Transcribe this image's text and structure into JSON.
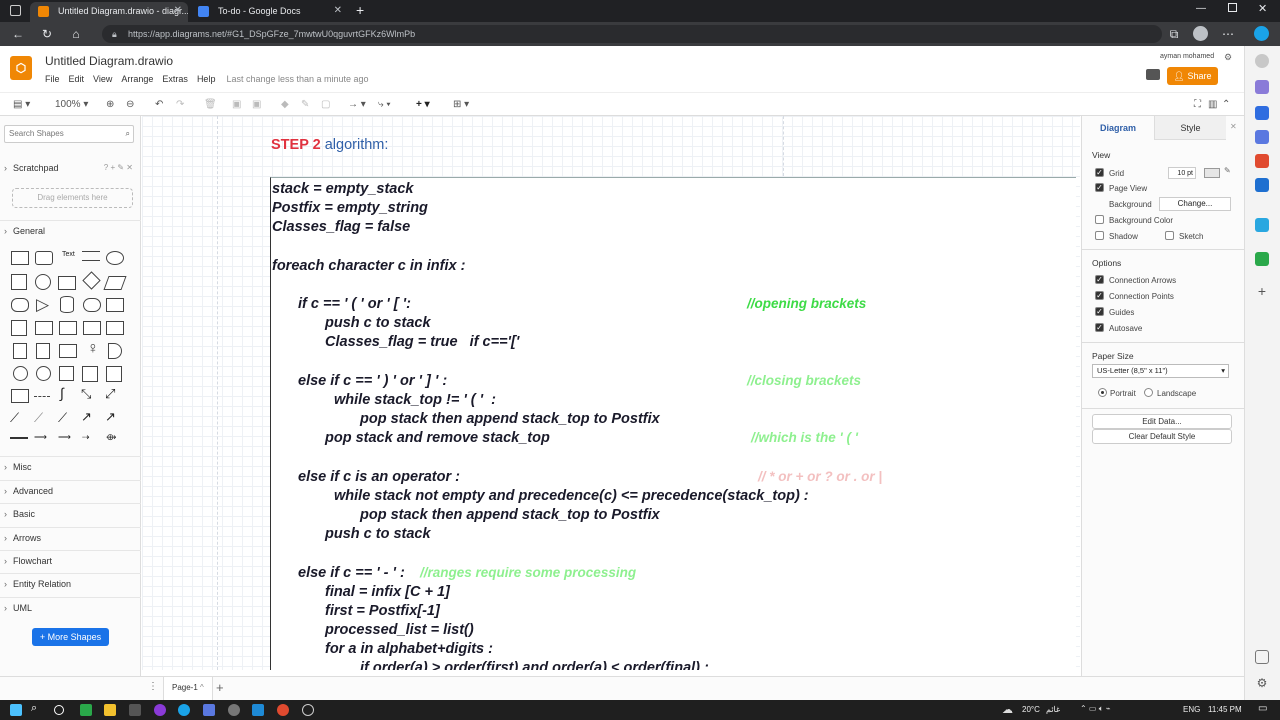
{
  "browser": {
    "tabs": [
      {
        "label": "Untitled Diagram.drawio - diagr...",
        "active": true
      },
      {
        "label": "To-do - Google Docs",
        "active": false
      }
    ],
    "url": "https://app.diagrams.net/#G1_DSpGFze_7mwtwU0qguvrtGFKz6WlmPb"
  },
  "app": {
    "title": "Untitled Diagram.drawio",
    "menu": [
      "File",
      "Edit",
      "View",
      "Arrange",
      "Extras",
      "Help"
    ],
    "last_change": "Last change less than a minute ago",
    "user": "ayman mohamed",
    "share_label": "Share",
    "zoom": "100%"
  },
  "left_panel": {
    "search_placeholder": "Search Shapes",
    "scratchpad": "Scratchpad",
    "drop_hint": "Drag elements here",
    "sections": [
      "General",
      "Misc",
      "Advanced",
      "Basic",
      "Arrows",
      "Flowchart",
      "Entity Relation",
      "UML"
    ],
    "more_shapes": "+ More Shapes"
  },
  "canvas": {
    "heading_step": "STEP 2",
    "heading_rest": "algorithm:",
    "lines": [
      "stack = empty_stack",
      "Postfix = empty_string",
      "Classes_flag = false",
      "foreach character c in infix :",
      "if c == ' ( ' or ' [ ':",
      "push c to stack",
      "Classes_flag = true   if c=='['",
      "else if c == ' ) ' or ' ] ' :",
      "while stack_top != ' ( '  :",
      "pop stack then append stack_top to Postfix",
      "pop stack and remove stack_top",
      "else if c is an operator :",
      "while stack not empty and precedence(c) <= precedence(stack_top) :",
      "pop stack then append stack_top to Postfix",
      "push c to stack",
      "else if c == ' - ' :",
      "final = infix [C + 1]",
      "first = Postfix[-1]",
      "processed_list = list()",
      "for a in alphabet+digits :",
      "if order(a) > order(first) and order(a) < order(final) :"
    ],
    "comments": {
      "opening": "//opening brackets",
      "closing": "//closing brackets",
      "which": "//which is the ' ( '",
      "ops": "// * or + or ? or . or |",
      "ranges": "//ranges require some processing"
    }
  },
  "right_panel": {
    "tabs": [
      "Diagram",
      "Style"
    ],
    "view_head": "View",
    "grid_label": "Grid",
    "grid_value": "10 pt",
    "page_view": "Page View",
    "background": "Background",
    "change_btn": "Change...",
    "bg_color": "Background Color",
    "shadow": "Shadow",
    "sketch": "Sketch",
    "options_head": "Options",
    "options": [
      "Connection Arrows",
      "Connection Points",
      "Guides",
      "Autosave"
    ],
    "paper_head": "Paper Size",
    "paper_value": "US-Letter (8,5\" x 11\")",
    "portrait": "Portrait",
    "landscape": "Landscape",
    "edit_data": "Edit Data...",
    "clear_style": "Clear Default Style"
  },
  "pagebar": {
    "page": "Page-1"
  },
  "taskbar": {
    "weather": "20°C",
    "weather_text": "غائم",
    "lang": "ENG",
    "time": "11:45 PM"
  }
}
